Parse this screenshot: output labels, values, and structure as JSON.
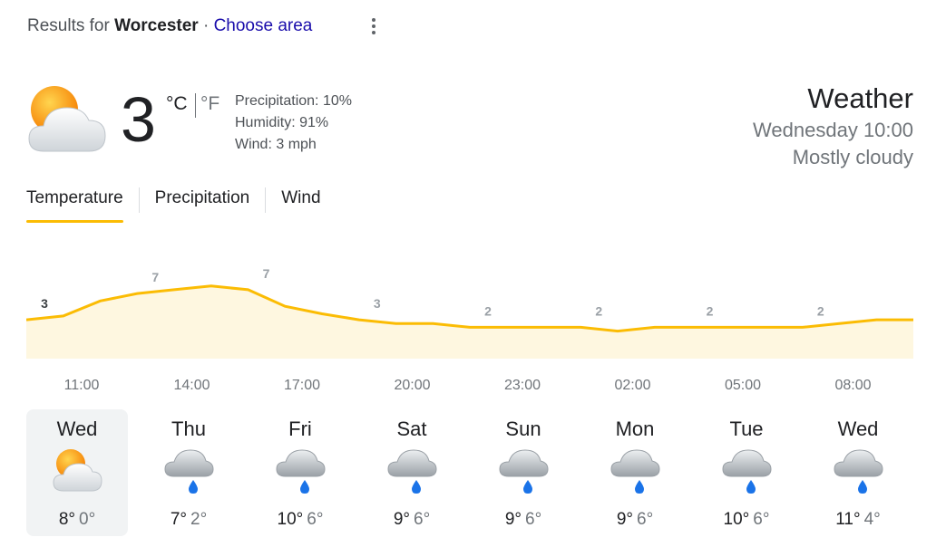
{
  "header": {
    "results_prefix": "Results for",
    "location": "Worcester",
    "separator": "·",
    "choose_area": "Choose area"
  },
  "current": {
    "temp": "3",
    "unit_c": "°C",
    "unit_f": "°F",
    "active_unit": "C",
    "icon": "partly-cloudy-icon",
    "precipitation": "Precipitation: 10%",
    "humidity": "Humidity: 91%",
    "wind": "Wind: 3 mph"
  },
  "summary": {
    "title": "Weather",
    "day_time": "Wednesday 10:00",
    "condition": "Mostly cloudy"
  },
  "tabs": [
    {
      "label": "Temperature",
      "active": true
    },
    {
      "label": "Precipitation",
      "active": false
    },
    {
      "label": "Wind",
      "active": false
    }
  ],
  "colors": {
    "accent": "#fbbc04",
    "link": "#1a0dab",
    "sun": "#f9a825",
    "rain": "#1a73e8"
  },
  "chart_data": {
    "type": "area",
    "x": [
      "10:00",
      "11:00",
      "12:00",
      "13:00",
      "14:00",
      "15:00",
      "16:00",
      "17:00",
      "18:00",
      "19:00",
      "20:00",
      "21:00",
      "22:00",
      "23:00",
      "00:00",
      "01:00",
      "02:00",
      "03:00",
      "04:00",
      "05:00",
      "06:00",
      "07:00",
      "08:00",
      "09:00"
    ],
    "values": [
      3,
      3.5,
      5.5,
      6.5,
      7,
      7.5,
      7,
      4.8,
      3.8,
      3,
      2.5,
      2.5,
      2,
      2,
      2,
      2,
      1.5,
      2,
      2,
      2,
      2,
      2,
      2.5,
      3
    ],
    "data_labels": [
      {
        "index": 0,
        "text": "3"
      },
      {
        "index": 3,
        "text": "7"
      },
      {
        "index": 6,
        "text": "7"
      },
      {
        "index": 9,
        "text": "3"
      },
      {
        "index": 12,
        "text": "2"
      },
      {
        "index": 15,
        "text": "2"
      },
      {
        "index": 18,
        "text": "2"
      },
      {
        "index": 21,
        "text": "2"
      }
    ],
    "tick_labels": [
      "11:00",
      "14:00",
      "17:00",
      "20:00",
      "23:00",
      "02:00",
      "05:00",
      "08:00"
    ],
    "ylim": [
      -10,
      10
    ]
  },
  "forecast": [
    {
      "day": "Wed",
      "high": "8°",
      "low": "0°",
      "icon": "partly-cloudy-icon",
      "selected": true
    },
    {
      "day": "Thu",
      "high": "7°",
      "low": "2°",
      "icon": "rain-cloud-icon",
      "selected": false
    },
    {
      "day": "Fri",
      "high": "10°",
      "low": "6°",
      "icon": "rain-cloud-icon",
      "selected": false
    },
    {
      "day": "Sat",
      "high": "9°",
      "low": "6°",
      "icon": "rain-cloud-icon",
      "selected": false
    },
    {
      "day": "Sun",
      "high": "9°",
      "low": "6°",
      "icon": "rain-cloud-icon",
      "selected": false
    },
    {
      "day": "Mon",
      "high": "9°",
      "low": "6°",
      "icon": "rain-cloud-icon",
      "selected": false
    },
    {
      "day": "Tue",
      "high": "10°",
      "low": "6°",
      "icon": "rain-cloud-icon",
      "selected": false
    },
    {
      "day": "Wed",
      "high": "11°",
      "low": "4°",
      "icon": "rain-cloud-icon",
      "selected": false
    }
  ]
}
